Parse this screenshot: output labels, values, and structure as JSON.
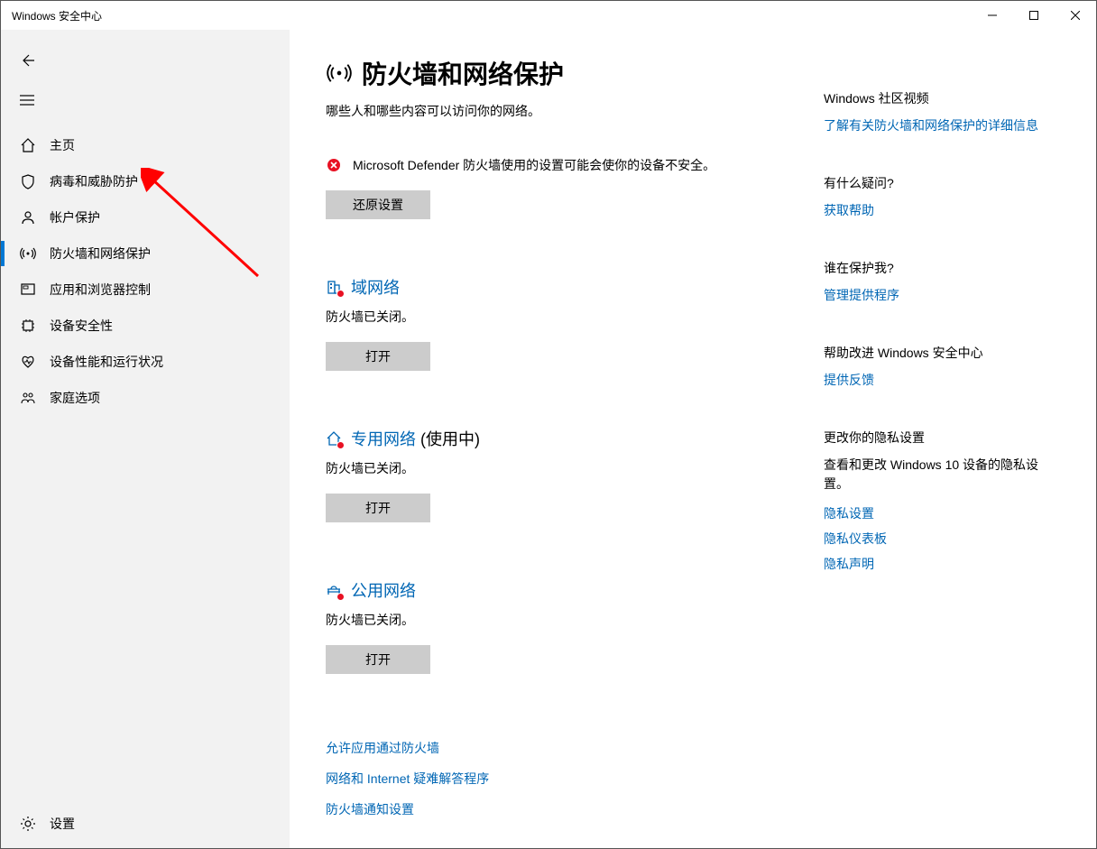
{
  "window": {
    "title": "Windows 安全中心"
  },
  "sidebar": {
    "items": [
      {
        "label": "主页"
      },
      {
        "label": "病毒和威胁防护"
      },
      {
        "label": "帐户保护"
      },
      {
        "label": "防火墙和网络保护"
      },
      {
        "label": "应用和浏览器控制"
      },
      {
        "label": "设备安全性"
      },
      {
        "label": "设备性能和运行状况"
      },
      {
        "label": "家庭选项"
      }
    ],
    "settings": "设置"
  },
  "page": {
    "title": "防火墙和网络保护",
    "subtitle": "哪些人和哪些内容可以访问你的网络。",
    "warning": "Microsoft Defender 防火墙使用的设置可能会使你的设备不安全。",
    "restore_btn": "还原设置",
    "networks": [
      {
        "title": "域网络",
        "suffix": "",
        "status": "防火墙已关闭。",
        "btn": "打开"
      },
      {
        "title": "专用网络",
        "suffix": "  (使用中)",
        "status": "防火墙已关闭。",
        "btn": "打开"
      },
      {
        "title": "公用网络",
        "suffix": "",
        "status": "防火墙已关闭。",
        "btn": "打开"
      }
    ],
    "bottom_links": [
      "允许应用通过防火墙",
      "网络和 Internet 疑难解答程序",
      "防火墙通知设置"
    ]
  },
  "right": {
    "blocks": [
      {
        "heading": "Windows 社区视频",
        "links": [
          "了解有关防火墙和网络保护的详细信息"
        ]
      },
      {
        "heading": "有什么疑问?",
        "links": [
          "获取帮助"
        ]
      },
      {
        "heading": "谁在保护我?",
        "links": [
          "管理提供程序"
        ]
      },
      {
        "heading": "帮助改进 Windows 安全中心",
        "links": [
          "提供反馈"
        ]
      },
      {
        "heading": "更改你的隐私设置",
        "text": "查看和更改 Windows 10 设备的隐私设置。",
        "links": [
          "隐私设置",
          "隐私仪表板",
          "隐私声明"
        ]
      }
    ]
  }
}
